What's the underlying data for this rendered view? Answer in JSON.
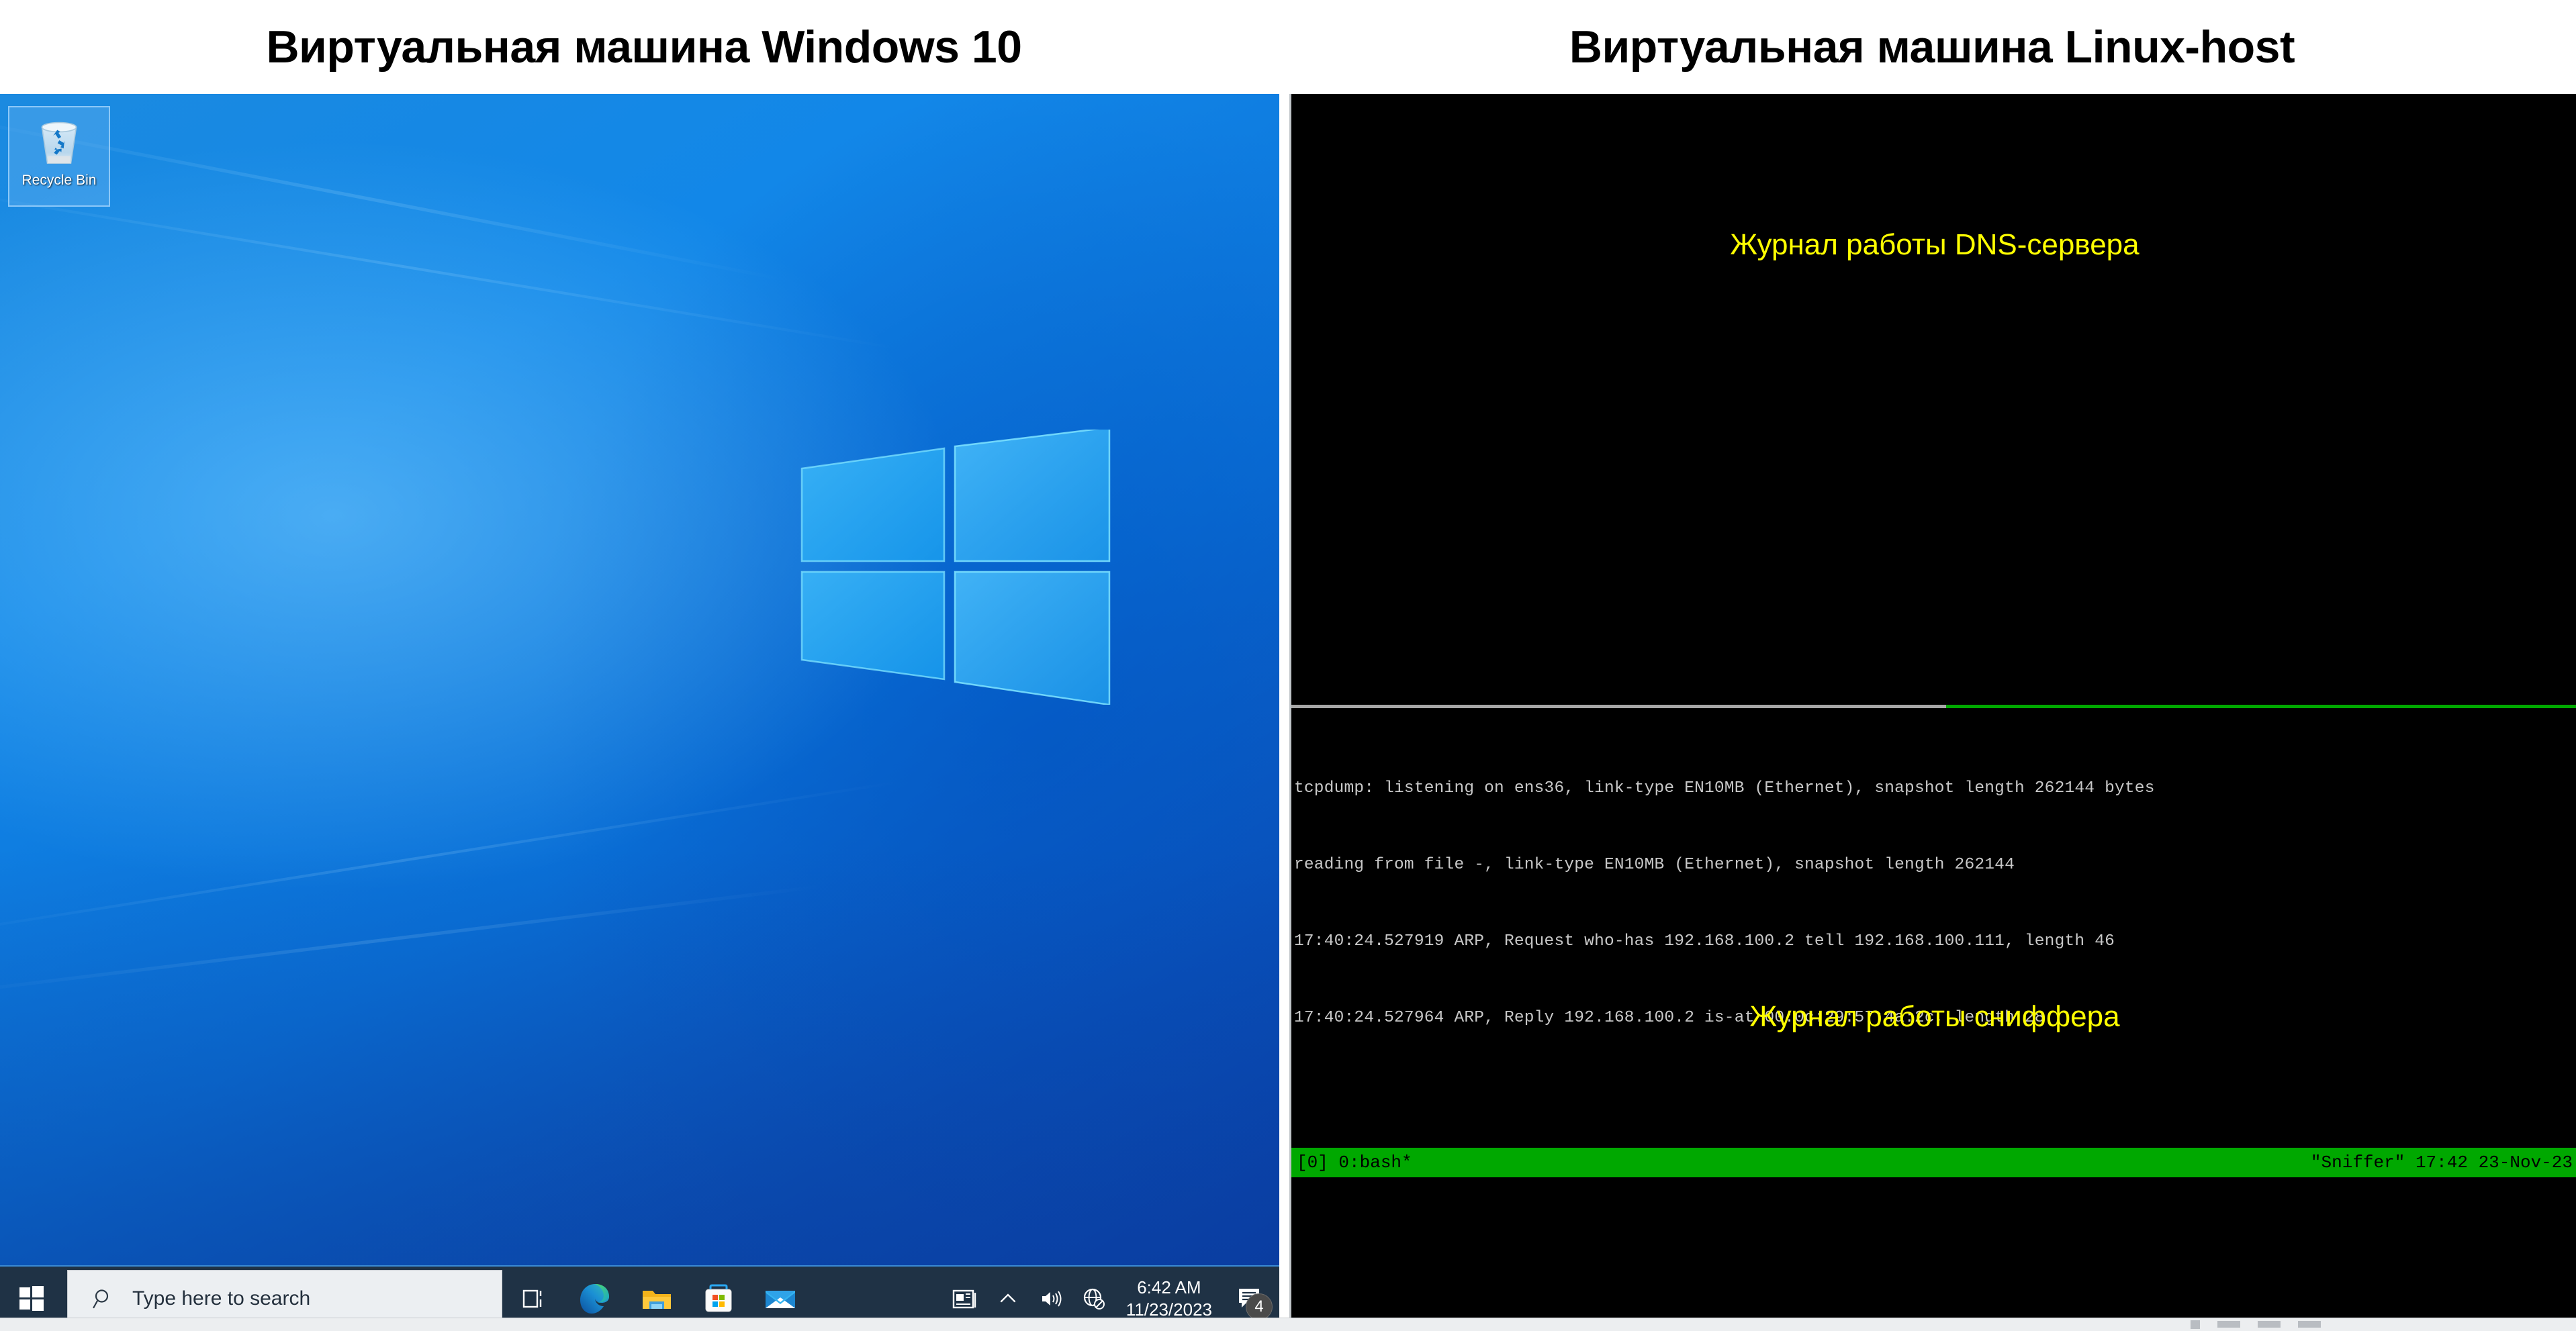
{
  "titles": {
    "left": "Виртуальная машина Windows 10",
    "right": "Виртуальная машина Linux-host"
  },
  "windows": {
    "desktop_icon": {
      "label": "Recycle Bin",
      "icon": "recycle-bin-icon",
      "selected": true
    },
    "taskbar": {
      "start_icon": "windows-start-icon",
      "search_placeholder": "Type here to search",
      "search_icon": "search-icon",
      "task_view_icon": "task-view-icon",
      "pinned": [
        {
          "name": "edge-icon",
          "label": "Microsoft Edge"
        },
        {
          "name": "file-explorer-icon",
          "label": "File Explorer"
        },
        {
          "name": "microsoft-store-icon",
          "label": "Microsoft Store"
        },
        {
          "name": "mail-icon",
          "label": "Mail"
        }
      ],
      "tray": {
        "news_icon": "news-and-interests-icon",
        "overflow_icon": "show-hidden-icons-chevron",
        "volume_icon": "volume-icon",
        "network_icon": "network-no-internet-icon",
        "time": "6:42 AM",
        "date": "11/23/2023",
        "action_center_icon": "action-center-icon",
        "notification_count": "4"
      }
    }
  },
  "linux": {
    "annotations": {
      "dns_log": "Журнал работы DNS-сервера",
      "sniffer_log": "Журнал работы сниффера"
    },
    "divider": {
      "inactive_color": "#a6a6a6",
      "active_color": "#00a800"
    },
    "terminal": {
      "lines": [
        "tcpdump: listening on ens36, link-type EN10MB (Ethernet), snapshot length 262144 bytes",
        "reading from file -, link-type EN10MB (Ethernet), snapshot length 262144",
        "17:40:24.527919 ARP, Request who-has 192.168.100.2 tell 192.168.100.111, length 46",
        "17:40:24.527964 ARP, Reply 192.168.100.2 is-at 00:0c:29:57:4a:2c, length 28"
      ]
    },
    "status_bar": {
      "left": "[0] 0:bash*",
      "right": "\"Sniffer\" 17:42 23-Nov-23",
      "background": "#00a800",
      "foreground": "#000000"
    }
  }
}
